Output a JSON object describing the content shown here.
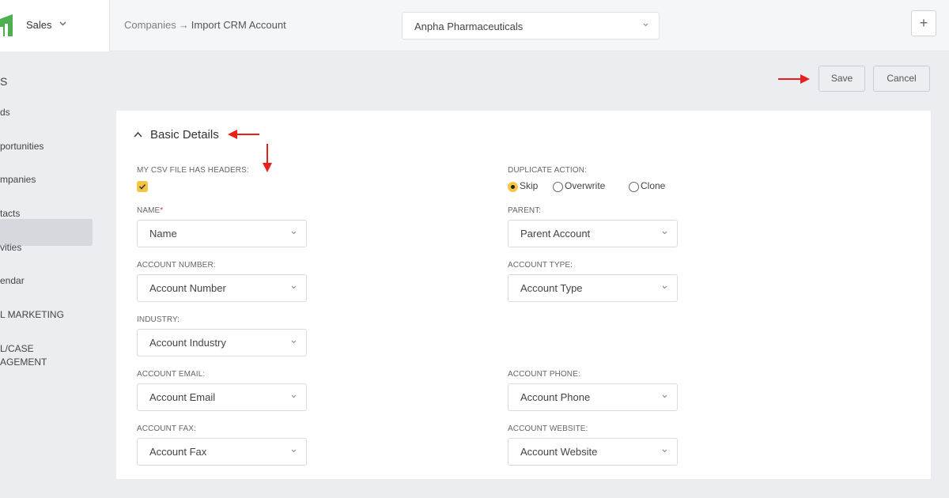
{
  "topbar": {
    "app_name": "Sales",
    "breadcrumb": {
      "parent": "Companies",
      "separator": "→",
      "current": "Import CRM Account"
    },
    "company_select": "Anpha Pharmaceuticals",
    "add_icon": "plus-icon"
  },
  "sidebar": {
    "items": [
      {
        "label": "S"
      },
      {
        "label": "ds"
      },
      {
        "label": "portunities"
      },
      {
        "label": "mpanies",
        "active": true
      },
      {
        "label": "tacts"
      },
      {
        "label": "vities"
      },
      {
        "label": "endar"
      },
      {
        "label": "L MARKETING"
      },
      {
        "label": "L/CASE"
      },
      {
        "label": "AGEMENT"
      }
    ]
  },
  "actions": {
    "save": "Save",
    "cancel": "Cancel"
  },
  "form": {
    "section_title": "Basic Details",
    "csv_headers": {
      "label": "MY CSV FILE HAS HEADERS:",
      "checked": true
    },
    "duplicate_action": {
      "label": "DUPLICATE ACTION:",
      "options": [
        "Skip",
        "Overwrite",
        "Clone"
      ],
      "selected": "Skip"
    },
    "name": {
      "label": "NAME",
      "required_mark": "*",
      "value": "Name"
    },
    "parent": {
      "label": "PARENT:",
      "value": "Parent Account"
    },
    "account_number": {
      "label": "ACCOUNT NUMBER:",
      "value": "Account Number"
    },
    "account_type": {
      "label": "ACCOUNT TYPE:",
      "value": "Account Type"
    },
    "industry": {
      "label": "INDUSTRY:",
      "value": "Account Industry"
    },
    "account_email": {
      "label": "ACCOUNT EMAIL:",
      "value": "Account Email"
    },
    "account_phone": {
      "label": "ACCOUNT PHONE:",
      "value": "Account Phone"
    },
    "account_fax": {
      "label": "ACCOUNT FAX:",
      "value": "Account Fax"
    },
    "account_website": {
      "label": "ACCOUNT WEBSITE:",
      "value": "Account Website"
    }
  },
  "colors": {
    "accent": "#f6c542",
    "logo_green": "#4caf50",
    "annotation_red": "#e8201a",
    "required": "#e03333"
  }
}
